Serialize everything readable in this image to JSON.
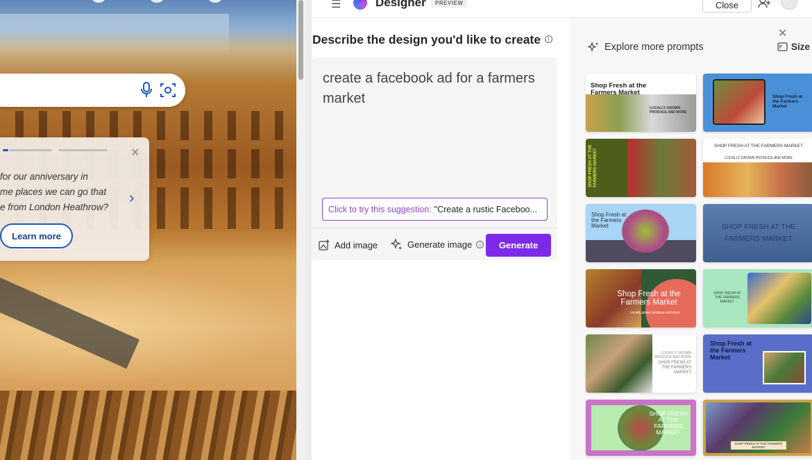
{
  "background_page": {
    "card": {
      "lines": [
        "for our anniversary in",
        "me places we can go that",
        "e from London Heathrow?"
      ],
      "learn_more": "Learn more"
    }
  },
  "designer": {
    "brand": "Designer",
    "badge": "PREVIEW",
    "close_label": "Close",
    "heading": "Describe the design you'd like to create",
    "prompt_value": "create a facebook ad for a farmers market",
    "suggestion": {
      "label": "Click to try this suggestion:",
      "text": "\"Create a rustic Faceboo..."
    },
    "actions": {
      "add_image": "Add image",
      "generate_image": "Generate image",
      "generate": "Generate"
    },
    "sidebar": {
      "explore": "Explore more prompts",
      "size": "Size",
      "thumbnails": [
        {
          "title": "Shop Fresh at the Farmers Market",
          "subtitle": "LOCALLY GROWN PRODUCE AND MORE"
        },
        {
          "title": "Shop Fresh at the Farmers Market"
        },
        {
          "title": "SHOP FRESH AT THE FARMERS MARKET"
        },
        {
          "title": "SHOP FRESH AT THE FARMERS MARKET",
          "subtitle": "LOCALLY GROWN PRODUCE AND MORE"
        },
        {
          "title": "Shop Fresh at the Farmers Market"
        },
        {
          "title": "SHOP FRESH AT THE FARMERS MARKET"
        },
        {
          "title": "Shop Fresh at the Farmers Market",
          "subtitle": "Locally grown produce and more"
        },
        {
          "title": "SHOP FRESH AT THE FARMERS MARKET"
        },
        {
          "title": "SHOP FRESH AT THE FARMERS MARKET",
          "subtitle": "LOCALLY GROWN PRODUCE AND MORE"
        },
        {
          "title": "Shop Fresh at the Farmers Market"
        },
        {
          "title": "SHOP FRESH AT THE FARMERS MARKET"
        },
        {
          "title": "SHOP FRESH AT THE FARMERS MARKET"
        }
      ]
    }
  },
  "colors": {
    "accent": "#7d2ae8",
    "suggestion_border": "#8e44c7",
    "link_blue": "#1a56c7"
  },
  "icons": [
    "mic-icon",
    "visual-search-icon",
    "chevron-right-icon",
    "close-icon",
    "hamburger-menu-icon",
    "designer-logo-icon",
    "share-icon",
    "avatar-icon",
    "info-icon",
    "add-image-icon",
    "sparkle-icon",
    "size-icon"
  ]
}
